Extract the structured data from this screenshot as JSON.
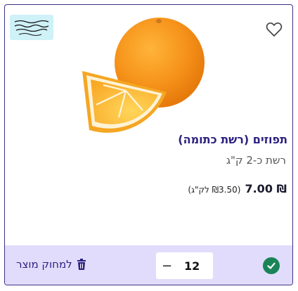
{
  "product": {
    "title": "תפוזים (רשת כתומה)",
    "subtitle": "רשת כ-2 ק\"ג",
    "price": "₪ 7.00",
    "unit_price": "(₪3.50 לק\"ג)"
  },
  "cart": {
    "quantity": "12",
    "minus_label": "−",
    "remove_label": "למחוק מוצר"
  },
  "icons": {
    "favorite": "heart-outline-icon",
    "kosher": "kosher-certification-logo",
    "in_cart": "check-circle-icon",
    "remove": "trash-icon"
  },
  "colors": {
    "accent": "#2c2180",
    "footer_bg": "#e1dcfb",
    "check_green": "#1a8457",
    "kosher_bg": "#cff1f8"
  }
}
